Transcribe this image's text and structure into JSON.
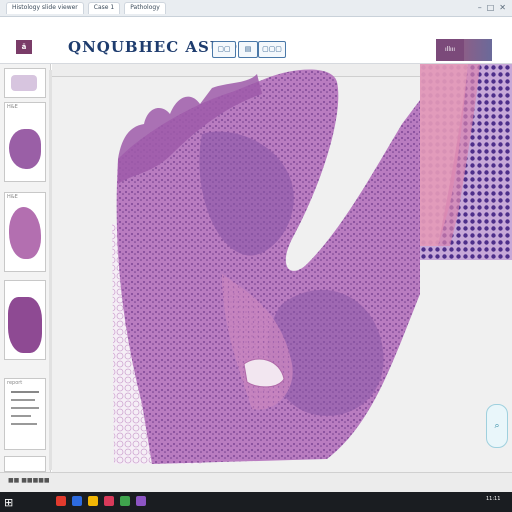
{
  "browser": {
    "tabs": [
      "Histology slide viewer",
      "Case 1",
      "Pathology"
    ],
    "window_controls": [
      "–",
      "□",
      "✕"
    ]
  },
  "app": {
    "title": "QNQUBHEC ASUO E",
    "logo": "ä",
    "buttons": [
      "▢▢",
      "▤",
      "▢▢▢"
    ],
    "brand_label": "ıllııı"
  },
  "sidebar": {
    "thumbnails": [
      {
        "caption": "",
        "stain": "#c9b6d2"
      },
      {
        "caption": "H&E",
        "stain": "#9a5fa6"
      },
      {
        "caption": "H&E",
        "stain": "#b36fb0"
      },
      {
        "caption": "",
        "stain": "#8e4a93"
      },
      {
        "caption": "report",
        "stain": "#ffffff"
      }
    ]
  },
  "viewer": {
    "zoom_icon": "⌕",
    "status": "■■ ■■■■■"
  },
  "taskbar": {
    "start_icon": "⊞",
    "clock": "11:11",
    "icon_colors": [
      "#e23b2e",
      "#2d6be0",
      "#f2b705",
      "#d93a5a",
      "#3fa34d",
      "#8d55c4"
    ]
  },
  "colors": {
    "tissue_pink": "#c98fc4",
    "tissue_purple": "#8a57a6",
    "background": "#f0f0f0"
  }
}
